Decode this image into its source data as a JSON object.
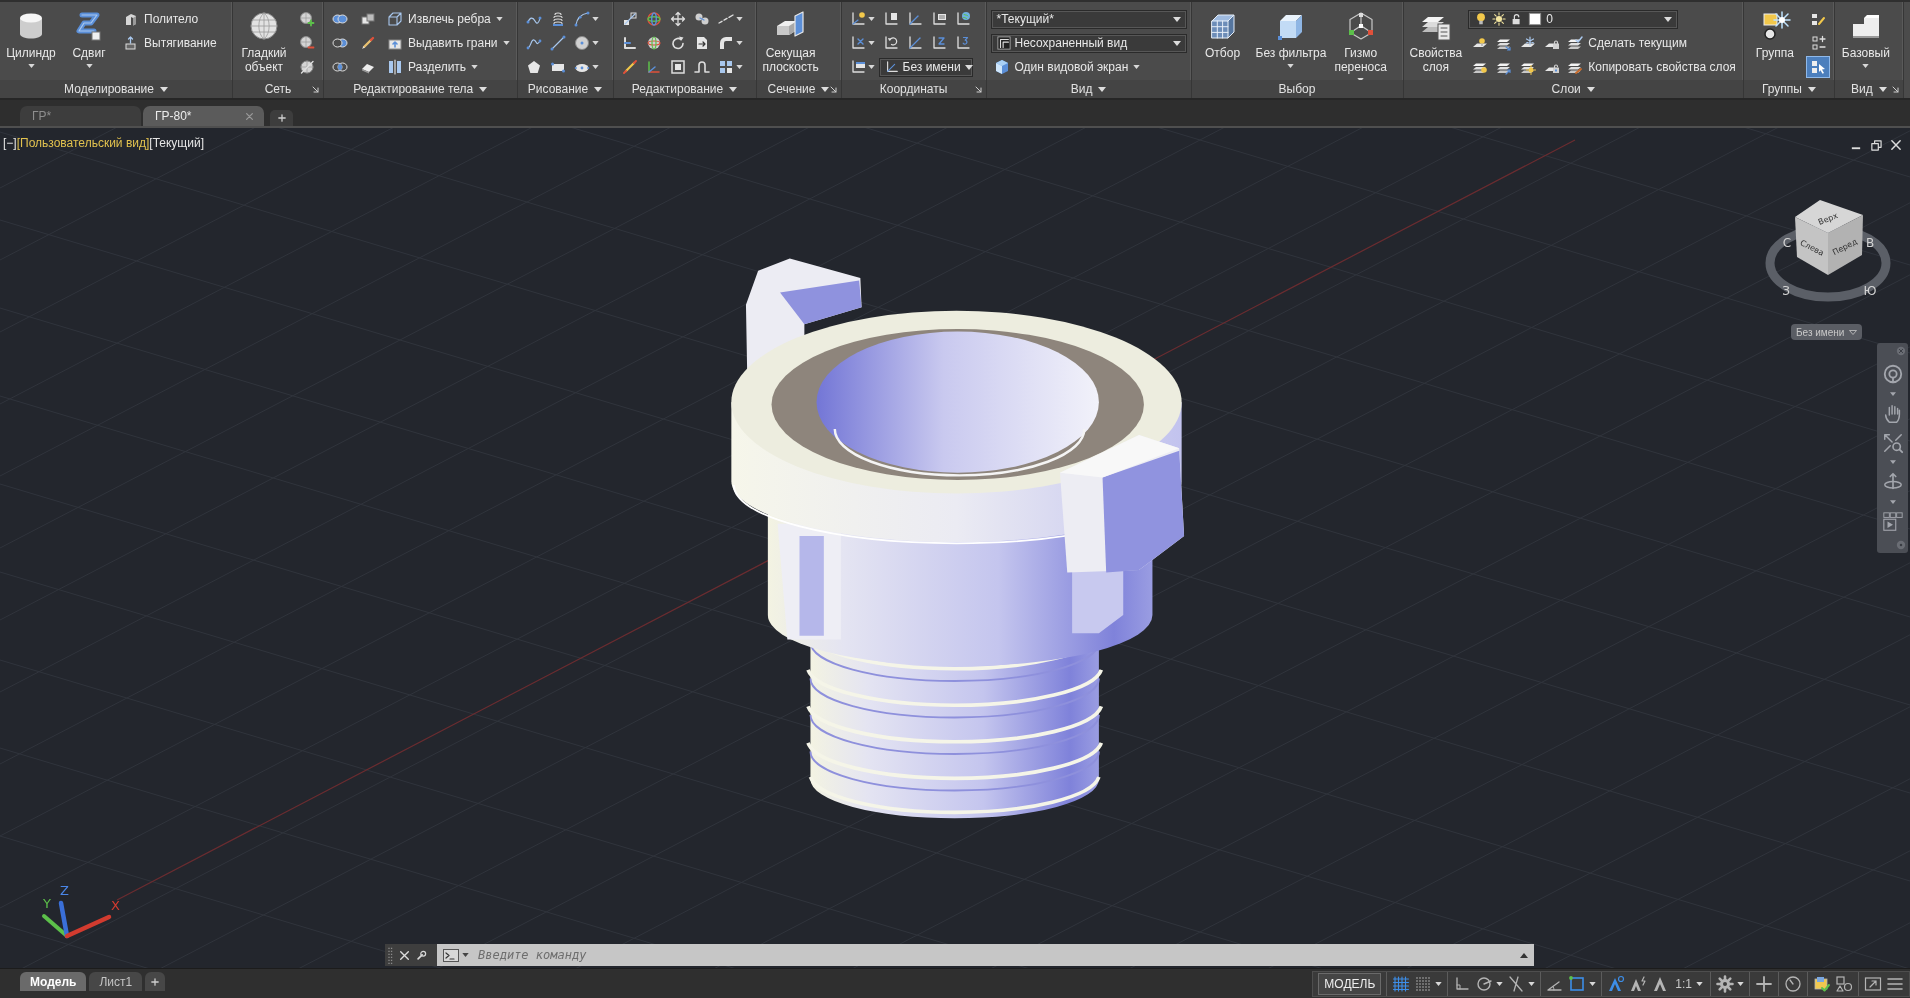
{
  "ribbon": {
    "panels": [
      {
        "title": "Моделирование",
        "menu": true,
        "launcher": false,
        "columns": [
          {
            "kind": "large",
            "label": "Цилиндр",
            "dropdown": true
          },
          {
            "kind": "large",
            "label": "Сдвиг",
            "dropdown": true
          },
          {
            "kind": "stack",
            "rows": [
              [
                {
                  "kind": "button",
                  "label": "Политело",
                  "dropdown": false
                }
              ],
              [
                {
                  "kind": "button",
                  "label": "Вытягивание",
                  "dropdown": false
                }
              ]
            ]
          }
        ]
      },
      {
        "title": "Сеть",
        "menu": false,
        "launcher": true,
        "columns": [
          {
            "kind": "large",
            "label": "Гладкий\nобъект",
            "dropdown": false
          },
          {
            "kind": "stack",
            "rows": [
              [
                {
                  "kind": "icon",
                  "dropdown": false
                }
              ],
              [
                {
                  "kind": "icon",
                  "dropdown": false
                }
              ],
              [
                {
                  "kind": "icon",
                  "dropdown": false
                }
              ]
            ]
          }
        ]
      },
      {
        "title": "Редактирование тела",
        "menu": true,
        "launcher": false,
        "columns": [
          {
            "kind": "stack",
            "rows": [
              [
                {
                  "kind": "icon",
                  "dropdown": false
                }
              ],
              [
                {
                  "kind": "icon",
                  "dropdown": false
                }
              ],
              [
                {
                  "kind": "icon",
                  "dropdown": false
                }
              ]
            ]
          },
          {
            "kind": "stack",
            "rows": [
              [
                {
                  "kind": "icon",
                  "dropdown": false
                }
              ],
              [
                {
                  "kind": "icon",
                  "dropdown": false
                }
              ],
              [
                {
                  "kind": "icon",
                  "dropdown": false
                }
              ]
            ]
          },
          {
            "kind": "stack",
            "rows": [
              [
                {
                  "kind": "button",
                  "label": "Извлечь ребра",
                  "dropdown": true
                }
              ],
              [
                {
                  "kind": "button",
                  "label": "Выдавить грани",
                  "dropdown": true
                }
              ],
              [
                {
                  "kind": "button",
                  "label": "Разделить",
                  "dropdown": true
                }
              ]
            ]
          }
        ]
      },
      {
        "title": "Рисование",
        "menu": true,
        "launcher": false,
        "columns": [
          {
            "kind": "stack",
            "rows": [
              [
                {
                  "kind": "icon",
                  "dropdown": false
                },
                {
                  "kind": "icon",
                  "dropdown": false
                },
                {
                  "kind": "icon",
                  "dropdown": true
                }
              ],
              [
                {
                  "kind": "icon",
                  "dropdown": false
                },
                {
                  "kind": "icon",
                  "dropdown": false
                },
                {
                  "kind": "icon",
                  "dropdown": true
                }
              ],
              [
                {
                  "kind": "icon",
                  "dropdown": false
                },
                {
                  "kind": "icon",
                  "dropdown": false
                },
                {
                  "kind": "icon",
                  "dropdown": true
                }
              ]
            ]
          }
        ]
      },
      {
        "title": "Редактирование",
        "menu": true,
        "launcher": false,
        "columns": [
          {
            "kind": "stack",
            "rows": [
              [
                {
                  "kind": "icon",
                  "dropdown": false
                },
                {
                  "kind": "icon",
                  "dropdown": false
                },
                {
                  "kind": "icon",
                  "dropdown": false
                },
                {
                  "kind": "icon",
                  "dropdown": false
                },
                {
                  "kind": "icon",
                  "dropdown": true
                }
              ],
              [
                {
                  "kind": "icon",
                  "dropdown": false
                },
                {
                  "kind": "icon",
                  "dropdown": false
                },
                {
                  "kind": "icon",
                  "dropdown": false
                },
                {
                  "kind": "icon",
                  "dropdown": false
                },
                {
                  "kind": "icon",
                  "dropdown": true
                }
              ],
              [
                {
                  "kind": "icon",
                  "dropdown": false
                },
                {
                  "kind": "icon",
                  "dropdown": false
                },
                {
                  "kind": "icon",
                  "dropdown": false
                },
                {
                  "kind": "icon",
                  "dropdown": false
                },
                {
                  "kind": "icon",
                  "dropdown": true
                }
              ]
            ]
          }
        ]
      },
      {
        "title": "Сечение",
        "menu": true,
        "launcher": true,
        "columns": [
          {
            "kind": "large",
            "label": "Секущая\nплоскость",
            "dropdown": false
          }
        ]
      },
      {
        "title": "Координаты",
        "menu": false,
        "launcher": true,
        "columns": [
          {
            "kind": "stack",
            "rows": [
              [
                {
                  "kind": "icon",
                  "dropdown": true
                },
                {
                  "kind": "icon",
                  "dropdown": false
                },
                {
                  "kind": "icon",
                  "dropdown": false
                },
                {
                  "kind": "icon",
                  "dropdown": false
                },
                {
                  "kind": "icon",
                  "dropdown": false
                }
              ],
              [
                {
                  "kind": "icon",
                  "dropdown": true
                },
                {
                  "kind": "icon",
                  "dropdown": false
                },
                {
                  "kind": "icon",
                  "dropdown": false
                },
                {
                  "kind": "icon",
                  "dropdown": false
                },
                {
                  "kind": "icon",
                  "dropdown": false
                }
              ],
              [
                {
                  "kind": "icon",
                  "dropdown": true
                },
                {
                  "kind": "combo",
                  "value": "Без имени"
                }
              ]
            ]
          }
        ]
      },
      {
        "title": "Вид",
        "menu": true,
        "launcher": false,
        "columns": [
          {
            "kind": "stack",
            "rows": [
              [
                {
                  "kind": "combo",
                  "value": "*Текущий*"
                }
              ],
              [
                {
                  "kind": "combo",
                  "value": "Несохраненный вид"
                }
              ],
              [
                {
                  "kind": "button",
                  "label": "Один видовой экран",
                  "dropdown": true
                }
              ]
            ]
          }
        ]
      },
      {
        "title": "Выбор",
        "menu": false,
        "launcher": false,
        "columns": [
          {
            "kind": "large",
            "label": "Отбор",
            "dropdown": false
          },
          {
            "kind": "large",
            "label": "Без фильтра",
            "dropdown": true
          },
          {
            "kind": "large",
            "label": "Гизмо\nпереноса",
            "dropdown": true
          }
        ]
      },
      {
        "title": "Слои",
        "menu": true,
        "launcher": false,
        "columns": [
          {
            "kind": "large",
            "label": "Свойства\nслоя",
            "dropdown": false
          },
          {
            "kind": "stack",
            "rows": [
              [
                {
                  "kind": "combo",
                  "value": "0"
                }
              ],
              [
                {
                  "kind": "icon",
                  "dropdown": false
                },
                {
                  "kind": "icon",
                  "dropdown": false
                },
                {
                  "kind": "icon",
                  "dropdown": false
                },
                {
                  "kind": "icon",
                  "dropdown": false
                },
                {
                  "kind": "button",
                  "label": "Сделать текущим",
                  "dropdown": false
                }
              ],
              [
                {
                  "kind": "icon",
                  "dropdown": false
                },
                {
                  "kind": "icon",
                  "dropdown": false
                },
                {
                  "kind": "icon",
                  "dropdown": false
                },
                {
                  "kind": "icon",
                  "dropdown": false
                },
                {
                  "kind": "button",
                  "label": "Копировать свойства слоя",
                  "dropdown": false
                }
              ]
            ]
          }
        ]
      },
      {
        "title": "Группы",
        "menu": true,
        "launcher": false,
        "columns": [
          {
            "kind": "large",
            "label": "Группа",
            "dropdown": false
          },
          {
            "kind": "stack",
            "rows": [
              [
                {
                  "kind": "icon",
                  "dropdown": false,
                  "on": false
                }
              ],
              [
                {
                  "kind": "icon",
                  "dropdown": false,
                  "on": false
                }
              ],
              [
                {
                  "kind": "icon",
                  "dropdown": false,
                  "on": true
                }
              ]
            ]
          }
        ]
      },
      {
        "title": "Вид",
        "menu": true,
        "launcher": true,
        "columns": [
          {
            "kind": "large",
            "label": "Базовый",
            "dropdown": true
          }
        ]
      }
    ]
  },
  "file_tabs": [
    {
      "label": "ГР*",
      "selected": false,
      "closable": false
    },
    {
      "label": "ГР-80*",
      "selected": true,
      "closable": true
    }
  ],
  "viewport": {
    "controls": [
      {
        "label": "[−]",
        "highlighted": false
      },
      {
        "label": "[Пользовательский вид]",
        "highlighted": true
      },
      {
        "label": "[Текущий]",
        "highlighted": false
      }
    ],
    "view_cube": {
      "faces": {
        "top": "Верх",
        "left": "Слева",
        "front": "Перед"
      },
      "compass": {
        "north": "С",
        "east": "В",
        "south": "Ю",
        "west": "З"
      },
      "ucs_menu": "Без имени"
    },
    "ucs_icon": {
      "x": "X",
      "y": "Y",
      "z": "Z"
    }
  },
  "command_line": {
    "placeholder": "Введите команду"
  },
  "layout_tabs": [
    {
      "label": "Модель",
      "selected": true
    },
    {
      "label": "Лист1",
      "selected": false
    }
  ],
  "status_bar": {
    "groups": [
      [
        {
          "kind": "mode",
          "label": "МОДЕЛЬ",
          "dropdown": false
        }
      ],
      [
        {
          "kind": "icon",
          "on": true,
          "dropdown": false
        },
        {
          "kind": "icon",
          "on": false,
          "dropdown": true
        }
      ],
      [
        {
          "kind": "icon",
          "on": false,
          "dropdown": false
        },
        {
          "kind": "icon",
          "on": false,
          "dropdown": true
        },
        {
          "kind": "icon",
          "on": false,
          "dropdown": true
        }
      ],
      [
        {
          "kind": "icon",
          "on": false,
          "dropdown": false
        },
        {
          "kind": "icon",
          "on": true,
          "dropdown": true
        }
      ],
      [
        {
          "kind": "icon",
          "on": true,
          "dropdown": false
        },
        {
          "kind": "icon",
          "on": false,
          "dropdown": false
        },
        {
          "kind": "icon",
          "on": false,
          "dropdown": false
        },
        {
          "kind": "scale",
          "label": "1:1",
          "dropdown": true
        }
      ],
      [
        {
          "kind": "icon",
          "on": false,
          "dropdown": true
        }
      ],
      [
        {
          "kind": "icon",
          "on": false,
          "dropdown": false
        }
      ],
      [
        {
          "kind": "icon",
          "on": false,
          "dropdown": false
        }
      ],
      [
        {
          "kind": "icon",
          "on": false,
          "dropdown": false
        },
        {
          "kind": "icon",
          "on": false,
          "dropdown": false
        }
      ],
      [
        {
          "kind": "icon",
          "on": false,
          "dropdown": false
        },
        {
          "kind": "icon",
          "on": false,
          "dropdown": false
        }
      ]
    ]
  }
}
